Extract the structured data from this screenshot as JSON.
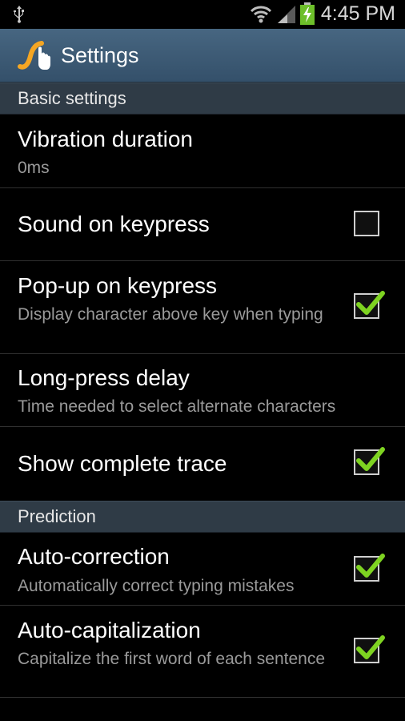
{
  "status_bar": {
    "time": "4:45 PM",
    "icons": [
      "usb-icon",
      "wifi-icon",
      "signal-icon",
      "battery-charging-icon"
    ]
  },
  "action_bar": {
    "title": "Settings",
    "icon": "app-swipe-icon"
  },
  "sections": {
    "basic": "Basic settings",
    "prediction": "Prediction"
  },
  "items": [
    {
      "label": "Vibration duration",
      "summary": "0ms"
    },
    {
      "label": "Sound on keypress",
      "checked": false
    },
    {
      "label": "Pop-up on keypress",
      "summary": "Display character above key when typing",
      "checked": true
    },
    {
      "label": "Long-press delay",
      "summary": "Time needed to select alternate characters"
    },
    {
      "label": "Show complete trace",
      "checked": true
    },
    {
      "label": "Auto-correction",
      "summary": "Automatically correct typing mistakes",
      "checked": true
    },
    {
      "label": "Auto-capitalization",
      "summary": "Capitalize the first word of each sentence",
      "checked": true
    }
  ],
  "colors": {
    "check_accent": "#7ed321",
    "section_bg": "#2f3b46",
    "actionbar_bg": "#3f5b75"
  }
}
